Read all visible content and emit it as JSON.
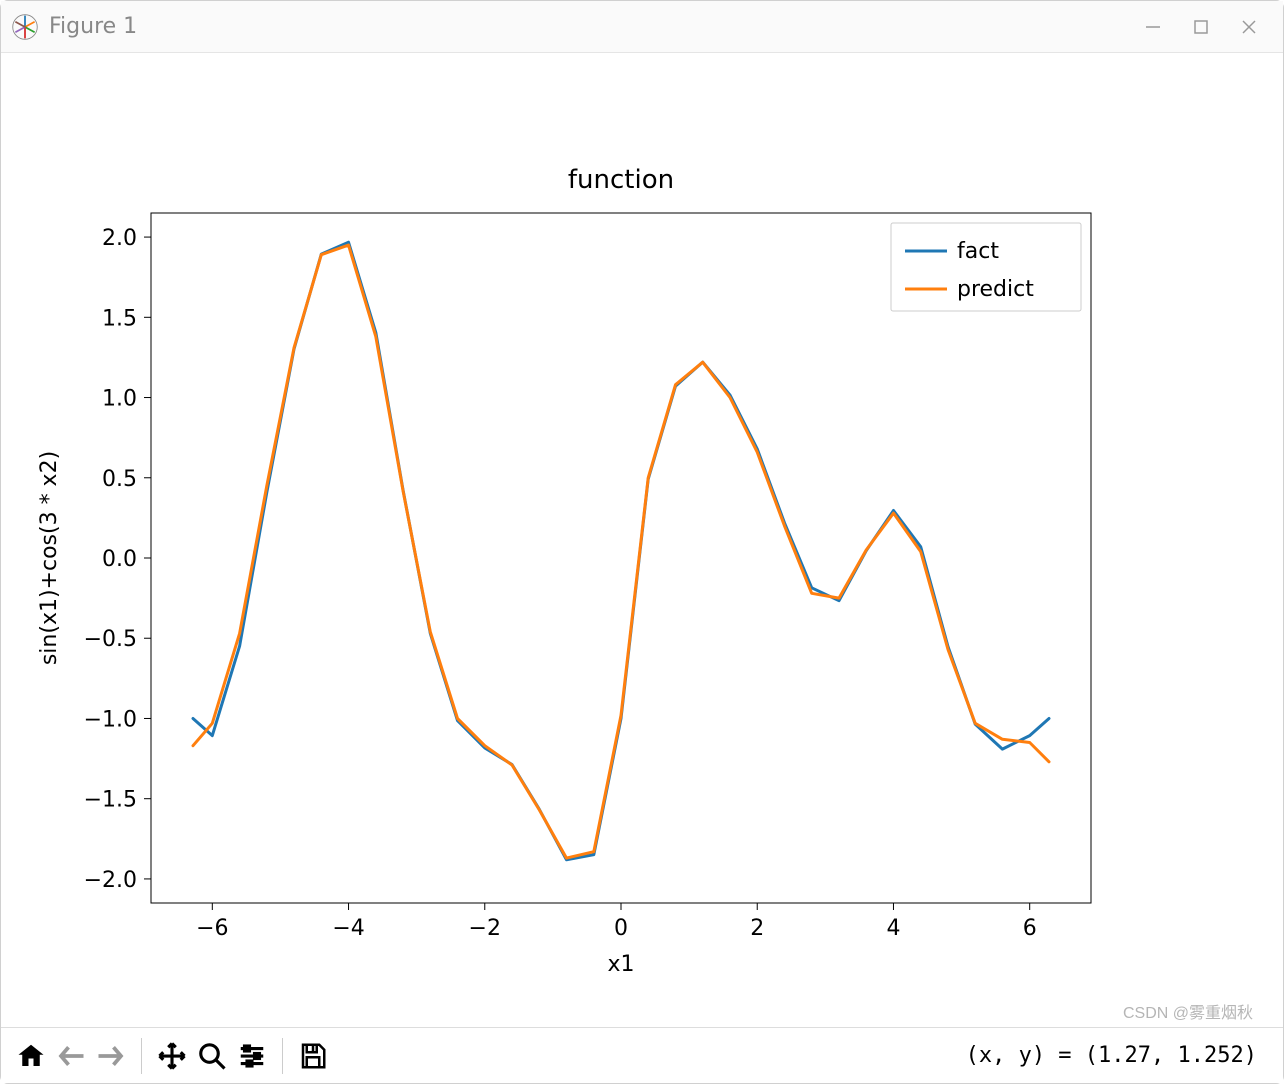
{
  "window": {
    "title": "Figure 1"
  },
  "toolbar": {
    "coord_readout": "(x, y) = (1.27, 1.252)"
  },
  "watermark": "CSDN @雾重烟秋",
  "chart_data": {
    "type": "line",
    "title": "function",
    "xlabel": "x1",
    "ylabel": "sin(x1)+cos(3 * x2)",
    "xlim": [
      -6.9,
      6.9
    ],
    "ylim": [
      -2.15,
      2.15
    ],
    "xticks": [
      -6,
      -4,
      -2,
      0,
      2,
      4,
      6
    ],
    "yticks": [
      -2.0,
      -1.5,
      -1.0,
      -0.5,
      0.0,
      0.5,
      1.0,
      1.5,
      2.0
    ],
    "legend_position": "upper right",
    "series": [
      {
        "name": "fact",
        "color": "#1f77b4",
        "x": [
          -6.283,
          -6.0,
          -5.6,
          -5.2,
          -4.8,
          -4.4,
          -4.0,
          -3.6,
          -3.2,
          -2.8,
          -2.4,
          -2.0,
          -1.6,
          -1.2,
          -0.8,
          -0.4,
          0.0,
          0.4,
          0.8,
          1.2,
          1.6,
          2.0,
          2.4,
          2.8,
          3.2,
          3.6,
          4.0,
          4.4,
          4.8,
          5.2,
          5.6,
          6.0,
          6.283
        ],
        "y": [
          -1.0,
          -1.107,
          -0.549,
          0.409,
          1.302,
          1.894,
          1.968,
          1.405,
          0.425,
          -0.47,
          -1.013,
          -1.184,
          -1.287,
          -1.566,
          -1.881,
          -1.849,
          -1.0,
          0.492,
          1.071,
          1.221,
          1.015,
          0.68,
          0.219,
          -0.186,
          -0.266,
          0.046,
          0.296,
          0.07,
          -0.552,
          -1.035,
          -1.191,
          -1.107,
          -1.0
        ]
      },
      {
        "name": "predict",
        "color": "#ff7f0e",
        "x": [
          -6.283,
          -6.0,
          -5.6,
          -5.2,
          -4.8,
          -4.4,
          -4.0,
          -3.6,
          -3.2,
          -2.8,
          -2.4,
          -2.0,
          -1.6,
          -1.2,
          -0.8,
          -0.4,
          0.0,
          0.4,
          0.8,
          1.2,
          1.6,
          2.0,
          2.4,
          2.8,
          3.2,
          3.6,
          4.0,
          4.4,
          4.8,
          5.2,
          5.6,
          6.0,
          6.283
        ],
        "y": [
          -1.17,
          -1.03,
          -0.47,
          0.45,
          1.31,
          1.89,
          1.95,
          1.38,
          0.42,
          -0.46,
          -1.0,
          -1.17,
          -1.29,
          -1.57,
          -1.87,
          -1.83,
          -0.98,
          0.5,
          1.08,
          1.22,
          1.0,
          0.66,
          0.2,
          -0.22,
          -0.25,
          0.05,
          0.28,
          0.04,
          -0.57,
          -1.03,
          -1.13,
          -1.15,
          -1.27
        ]
      }
    ]
  }
}
